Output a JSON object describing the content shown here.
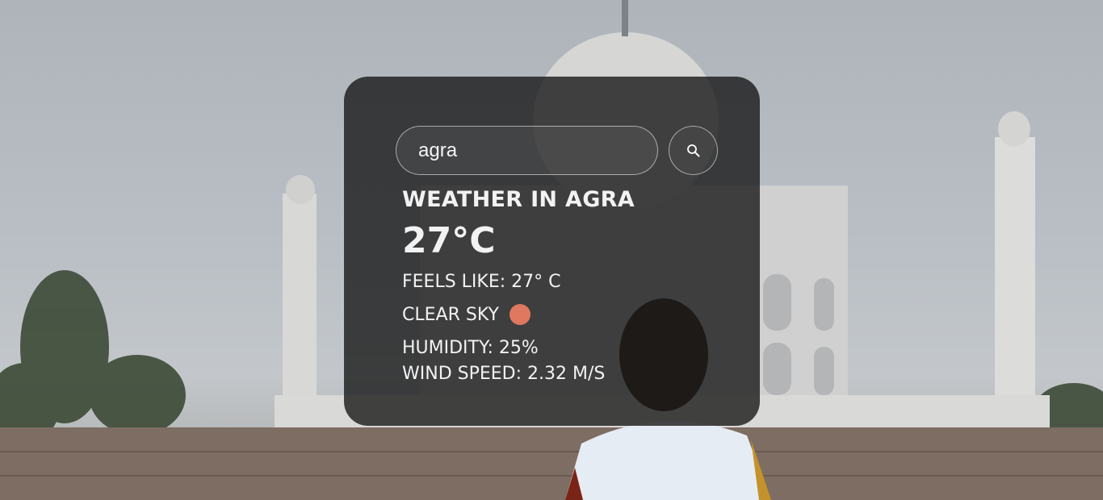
{
  "search": {
    "value": "agra",
    "button_icon": "search-icon"
  },
  "weather": {
    "city_heading": "WEATHER IN AGRA",
    "temperature": "27°C",
    "feels_like": "FEELS LIKE: 27° C",
    "description": "CLEAR SKY",
    "description_icon": "clear-sky-icon",
    "humidity": "HUMIDITY: 25%",
    "wind_speed": "WIND SPEED: 2.32 M/S"
  },
  "colors": {
    "card_background": "#141414",
    "text": "#f2f2f2",
    "sun_icon": "#e07860"
  }
}
